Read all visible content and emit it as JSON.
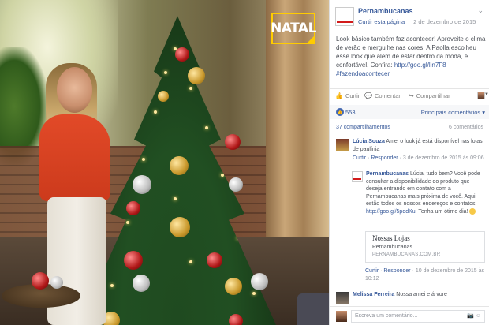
{
  "photo": {
    "badge_text": "NATAL",
    "colors": {
      "badge_border": "#ffcc00",
      "shirt": "#e24a28",
      "tree": "#214f22"
    }
  },
  "post": {
    "page_name": "Pernambucanas",
    "like_page_label": "Curtir esta página",
    "date": "2 de dezembro de 2015",
    "text_before_link": "Look básico também faz acontecer! Aproveite o clima de verão e mergulhe nas cores. A Paolla escolheu esse look que além de estar dentro da moda, é confortável. Confira: ",
    "link": "http://goo.gl/lln7F8",
    "hashtag": "#fazendoacontecer"
  },
  "actions": {
    "like": "Curtir",
    "comment": "Comentar",
    "share": "Compartilhar"
  },
  "stats": {
    "likes": "553",
    "top_comments": "Principais comentários",
    "shares": "37 compartilhamentos",
    "comments": "6 comentários"
  },
  "comments": [
    {
      "author": "Lúcia Souza",
      "text": " Amei o look já está disponível nas lojas de paulínia",
      "like": "Curtir",
      "reply": "Responder",
      "date": "3 de dezembro de 2015 às 09:06"
    },
    {
      "author": "Pernambucanas",
      "text_1": " Lúcia, tudo bem? Você pode consultar a disponibilidade do produto que deseja entrando em contato com a Pernambucanas mais próxima de você. Aqui estão todos os nossos endereços e contatos: ",
      "link": "http://goo.gl/5pqdKu",
      "text_2": ". Tenha um ótimo dia! ",
      "card_title": "Nossas Lojas",
      "card_sub": "Pernambucanas",
      "card_domain": "PERNAMBUCANAS.COM.BR",
      "like": "Curtir",
      "reply": "Responder",
      "date": "10 de dezembro de 2015 às 10:12"
    },
    {
      "author": "Melissa Ferreira",
      "text": " Nossa amei e árvore"
    }
  ],
  "write_comment": {
    "placeholder": "Escreva um comentário..."
  }
}
